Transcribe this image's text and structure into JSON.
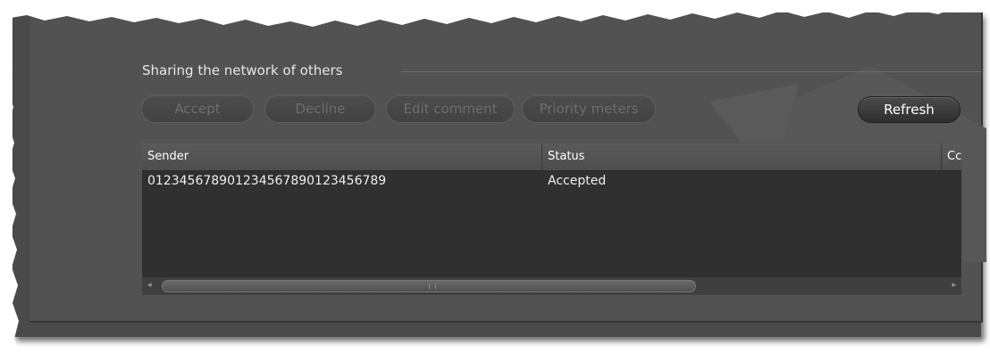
{
  "section": {
    "title": "Sharing the network of others"
  },
  "toolbar": {
    "accept_label": "Accept",
    "decline_label": "Decline",
    "edit_comment_label": "Edit comment",
    "priority_meters_label": "Priority meters",
    "refresh_label": "Refresh"
  },
  "table": {
    "columns": [
      "Sender",
      "Status",
      "Cc"
    ],
    "rows": [
      {
        "sender": "012345678901234567890123456789",
        "status": "Accepted"
      }
    ]
  },
  "scrollbar": {
    "left_arrow": "◂",
    "right_arrow": "▸"
  },
  "colors": {
    "panel_bg": "#525252",
    "disabled_text": "#6d6d6d",
    "grid_bg": "#303030"
  }
}
